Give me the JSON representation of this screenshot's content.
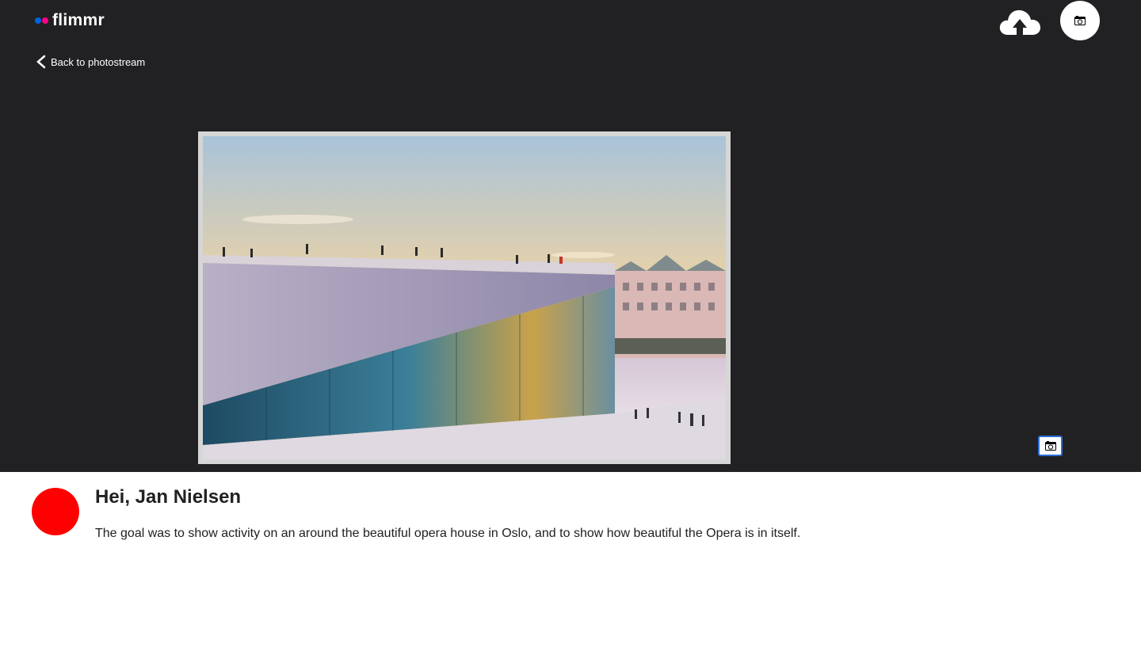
{
  "header": {
    "logo_text": "flimmr",
    "logo_colors": {
      "blue": "#0063dc",
      "pink": "#ff0084"
    },
    "upload_icon": "cloud-upload-icon",
    "profile_icon": "camera-icon"
  },
  "viewer": {
    "back_label": "Back to photostream",
    "photo_alt": "Oslo Opera House at sunset",
    "corner_icon": "camera-icon"
  },
  "photo_info": {
    "title": "Hei, Jan Nielsen",
    "description": "The goal was to show activity on an around the beautiful opera house in Oslo, and to show how beautiful the Opera is in itself.",
    "avatar_color": "#ff0000"
  }
}
